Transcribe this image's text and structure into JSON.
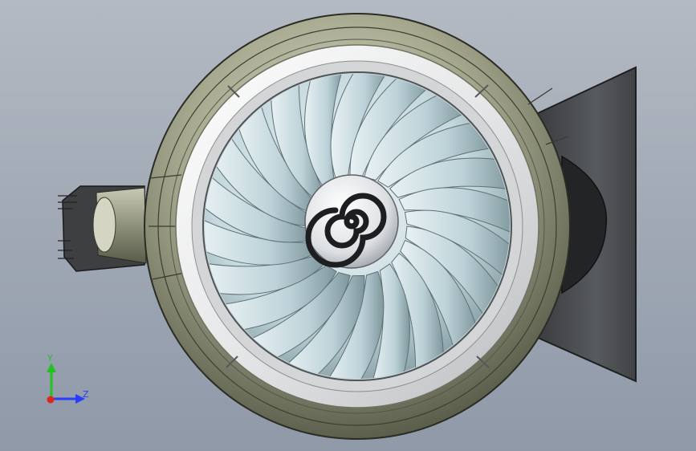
{
  "viewport": {
    "background_top": "#b4bac3",
    "background_bottom": "#8f99a8"
  },
  "model": {
    "blade_count": 22,
    "hub_icon": "spiral-spinner-icon"
  },
  "colors": {
    "nacelle": "#8f9377",
    "nacelle_light": "#c9cbb6",
    "lip_ring": "#f2f3f3",
    "blade": "#c9dde2",
    "blade_shadow": "#7f969c",
    "hub": "#e4e6e8",
    "mount": "#4e5154",
    "axis_y": "#21c321",
    "axis_z": "#2a3cff",
    "axis_x": "#e0261b"
  },
  "triad": {
    "y_label": "Y",
    "z_label": "Z"
  }
}
